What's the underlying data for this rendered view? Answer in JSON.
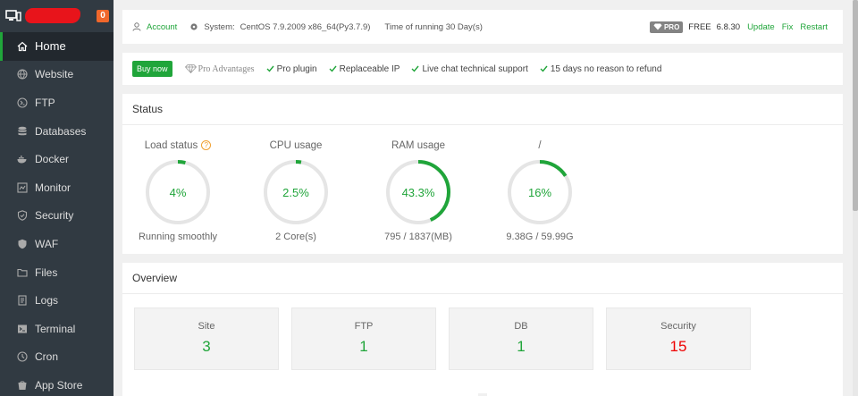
{
  "sidebar": {
    "badge": "0",
    "items": [
      {
        "label": "Home",
        "icon": "home-icon"
      },
      {
        "label": "Website",
        "icon": "globe-icon"
      },
      {
        "label": "FTP",
        "icon": "ftp-icon"
      },
      {
        "label": "Databases",
        "icon": "database-icon"
      },
      {
        "label": "Docker",
        "icon": "docker-icon"
      },
      {
        "label": "Monitor",
        "icon": "monitor-icon"
      },
      {
        "label": "Security",
        "icon": "shield-icon"
      },
      {
        "label": "WAF",
        "icon": "waf-icon"
      },
      {
        "label": "Files",
        "icon": "folder-icon"
      },
      {
        "label": "Logs",
        "icon": "logs-icon"
      },
      {
        "label": "Terminal",
        "icon": "terminal-icon"
      },
      {
        "label": "Cron",
        "icon": "clock-icon"
      },
      {
        "label": "App Store",
        "icon": "app-store-icon"
      }
    ]
  },
  "topbar": {
    "account": "Account",
    "system_label": "System:",
    "system_value": "CentOS 7.9.2009 x86_64(Py3.7.9)",
    "running": "Time of running 30 Day(s)",
    "pro_tag": "PRO",
    "plan": "FREE",
    "version": "6.8.30",
    "update": "Update",
    "fix": "Fix",
    "restart": "Restart"
  },
  "probar": {
    "buy_now": "Buy now",
    "pro_advantages": "Pro Advantages",
    "features": [
      "Pro plugin",
      "Replaceable IP",
      "Live chat technical support",
      "15 days no reason to refund"
    ]
  },
  "status": {
    "title": "Status",
    "gauges": [
      {
        "title": "Load status",
        "value": "4%",
        "fraction": 0.04,
        "sub": "Running smoothly"
      },
      {
        "title": "CPU usage",
        "value": "2.5%",
        "fraction": 0.025,
        "sub": "2 Core(s)"
      },
      {
        "title": "RAM usage",
        "value": "43.3%",
        "fraction": 0.433,
        "sub": "795 / 1837(MB)"
      },
      {
        "title": "/",
        "value": "16%",
        "fraction": 0.16,
        "sub": "9.38G / 59.99G"
      }
    ]
  },
  "overview": {
    "title": "Overview",
    "cards": [
      {
        "label": "Site",
        "value": "3"
      },
      {
        "label": "FTP",
        "value": "1"
      },
      {
        "label": "DB",
        "value": "1"
      },
      {
        "label": "Security",
        "value": "15"
      }
    ]
  },
  "colors": {
    "accent": "#20a53a",
    "sidebar": "#313a42",
    "sidebar_active": "#22282e",
    "badge": "#f0672b",
    "danger": "#e00000",
    "track": "#e5e5e5"
  }
}
